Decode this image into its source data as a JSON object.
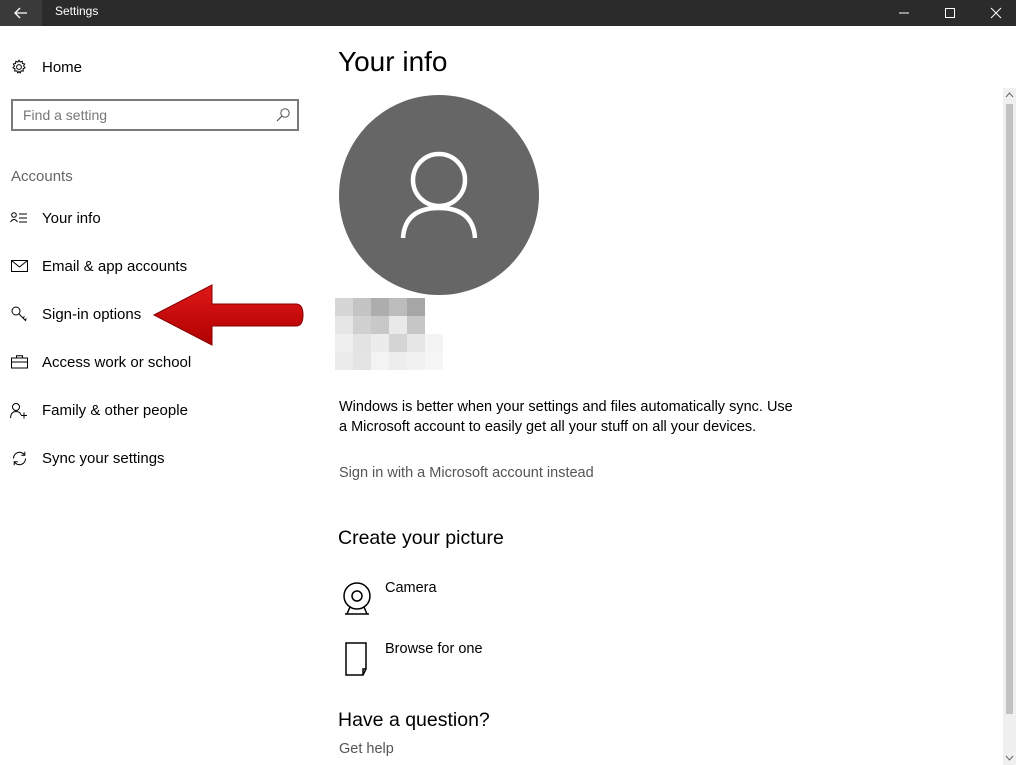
{
  "titlebar": {
    "title": "Settings",
    "back_icon": "back-arrow-icon",
    "controls": [
      "minimize-icon",
      "maximize-icon",
      "close-icon"
    ]
  },
  "nav": {
    "home_label": "Home",
    "home_icon": "gear-icon",
    "search_placeholder": "Find a setting",
    "search_icon": "search-icon",
    "section_label": "Accounts",
    "items": [
      {
        "label": "Your info",
        "icon": "contact-card-icon"
      },
      {
        "label": "Email & app accounts",
        "icon": "mail-icon"
      },
      {
        "label": "Sign-in options",
        "icon": "key-icon"
      },
      {
        "label": "Access work or school",
        "icon": "briefcase-icon"
      },
      {
        "label": "Family & other people",
        "icon": "add-person-icon"
      },
      {
        "label": "Sync your settings",
        "icon": "sync-icon"
      }
    ]
  },
  "annotation": {
    "color": "#cc0000",
    "icon": "red-arrow-icon"
  },
  "main": {
    "title": "Your info",
    "avatar_icon": "user-avatar-icon",
    "avatar_color": "#666666",
    "sync_text": "Windows is better when your settings and files automatically sync. Use a Microsoft account to easily get all your stuff on all your devices.",
    "sign_in_link": "Sign in with a Microsoft account instead",
    "picture_heading": "Create your picture",
    "picture_options": [
      {
        "label": "Camera",
        "icon": "camera-icon"
      },
      {
        "label": "Browse for one",
        "icon": "browse-icon"
      }
    ],
    "question_heading": "Have a question?",
    "help_link": "Get help"
  }
}
